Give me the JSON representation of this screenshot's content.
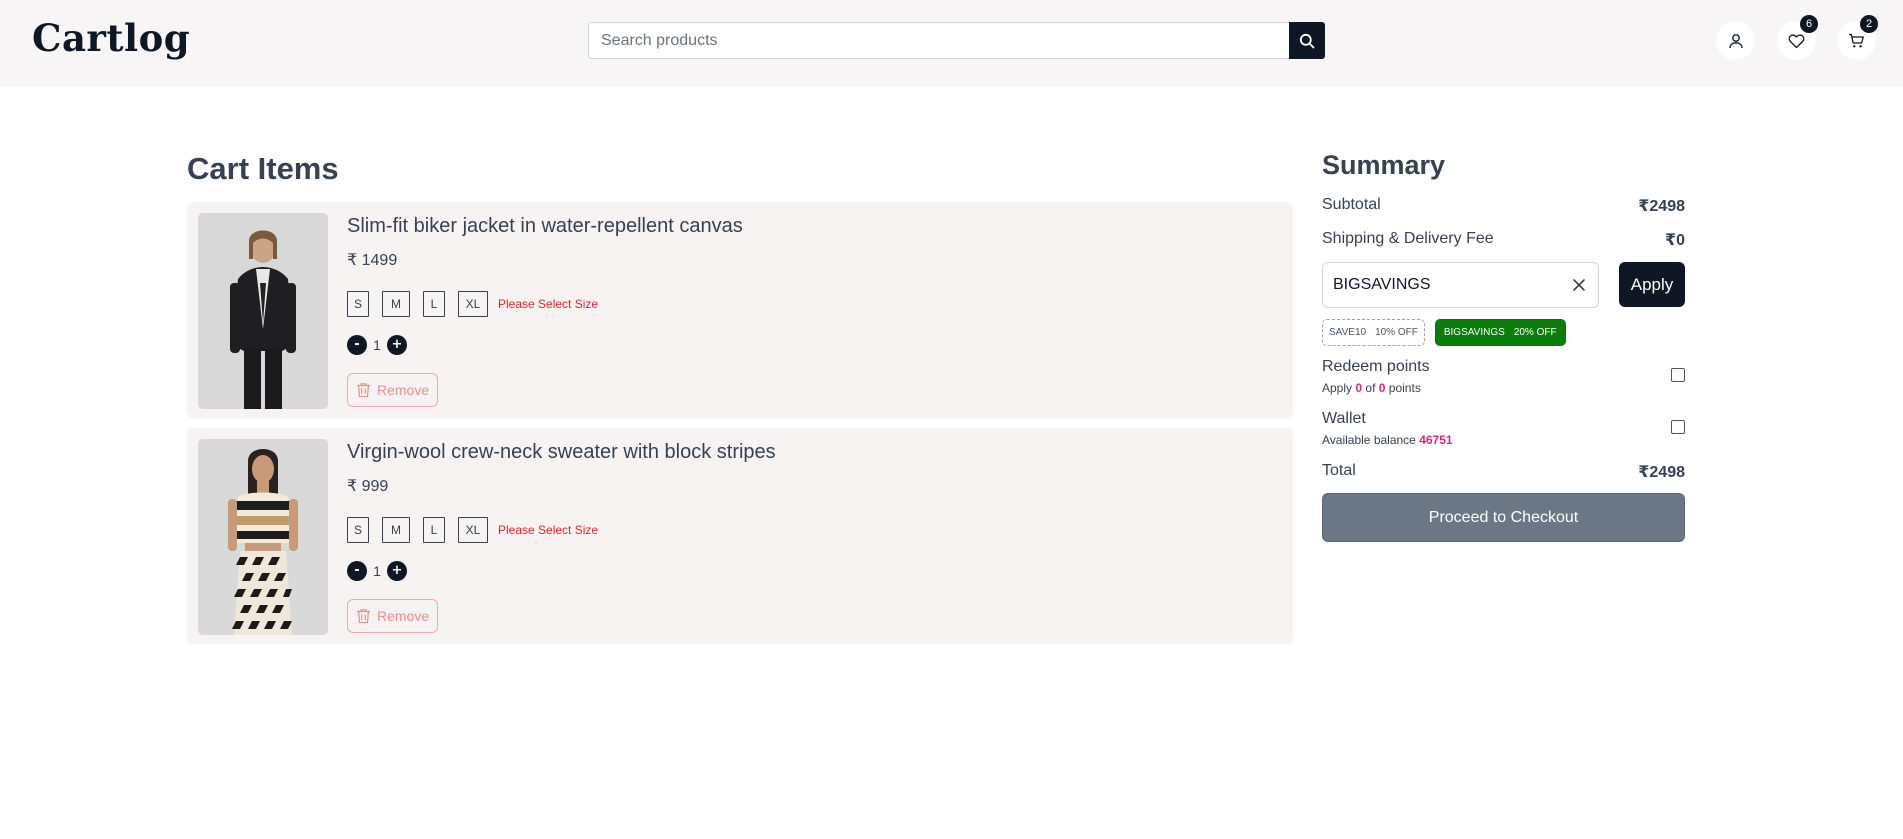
{
  "header": {
    "logo": "Cartlog",
    "search_placeholder": "Search products",
    "wishlist_count": "6",
    "cart_count": "2"
  },
  "cart": {
    "title": "Cart Items",
    "items": [
      {
        "name": "Slim-fit biker jacket in water-repellent canvas",
        "price": "₹ 1499",
        "sizes": [
          "S",
          "M",
          "L",
          "XL"
        ],
        "size_warning": "Please Select Size",
        "qty_minus": "-",
        "quantity": "1",
        "qty_plus": "+",
        "remove_label": "Remove"
      },
      {
        "name": "Virgin-wool crew-neck sweater with block stripes",
        "price": "₹ 999",
        "sizes": [
          "S",
          "M",
          "L",
          "XL"
        ],
        "size_warning": "Please Select Size",
        "qty_minus": "-",
        "quantity": "1",
        "qty_plus": "+",
        "remove_label": "Remove"
      }
    ]
  },
  "summary": {
    "title": "Summary",
    "subtotal_label": "Subtotal",
    "subtotal_value": "₹2498",
    "shipping_label": "Shipping & Delivery Fee",
    "shipping_value": "₹0",
    "coupon_value": "BIGSAVINGS",
    "apply_label": "Apply",
    "coupons": [
      {
        "code": "SAVE10",
        "discount": "10% OFF"
      },
      {
        "code": "BIGSAVINGS",
        "discount": "20% OFF"
      }
    ],
    "redeem_label": "Redeem points",
    "redeem_apply": "Apply",
    "redeem_points_used": "0",
    "redeem_of": "of",
    "redeem_points_total": "0",
    "redeem_points_word": "points",
    "wallet_label": "Wallet",
    "wallet_balance_label": "Available balance",
    "wallet_balance": "46751",
    "total_label": "Total",
    "total_value": "₹2498",
    "checkout_label": "Proceed to Checkout"
  },
  "colors": {
    "brand_dark": "#0f1724",
    "active_coupon": "#0b7d0b",
    "warning": "#e02424",
    "highlight": "#db2777",
    "checkout_button": "#6b7785"
  }
}
